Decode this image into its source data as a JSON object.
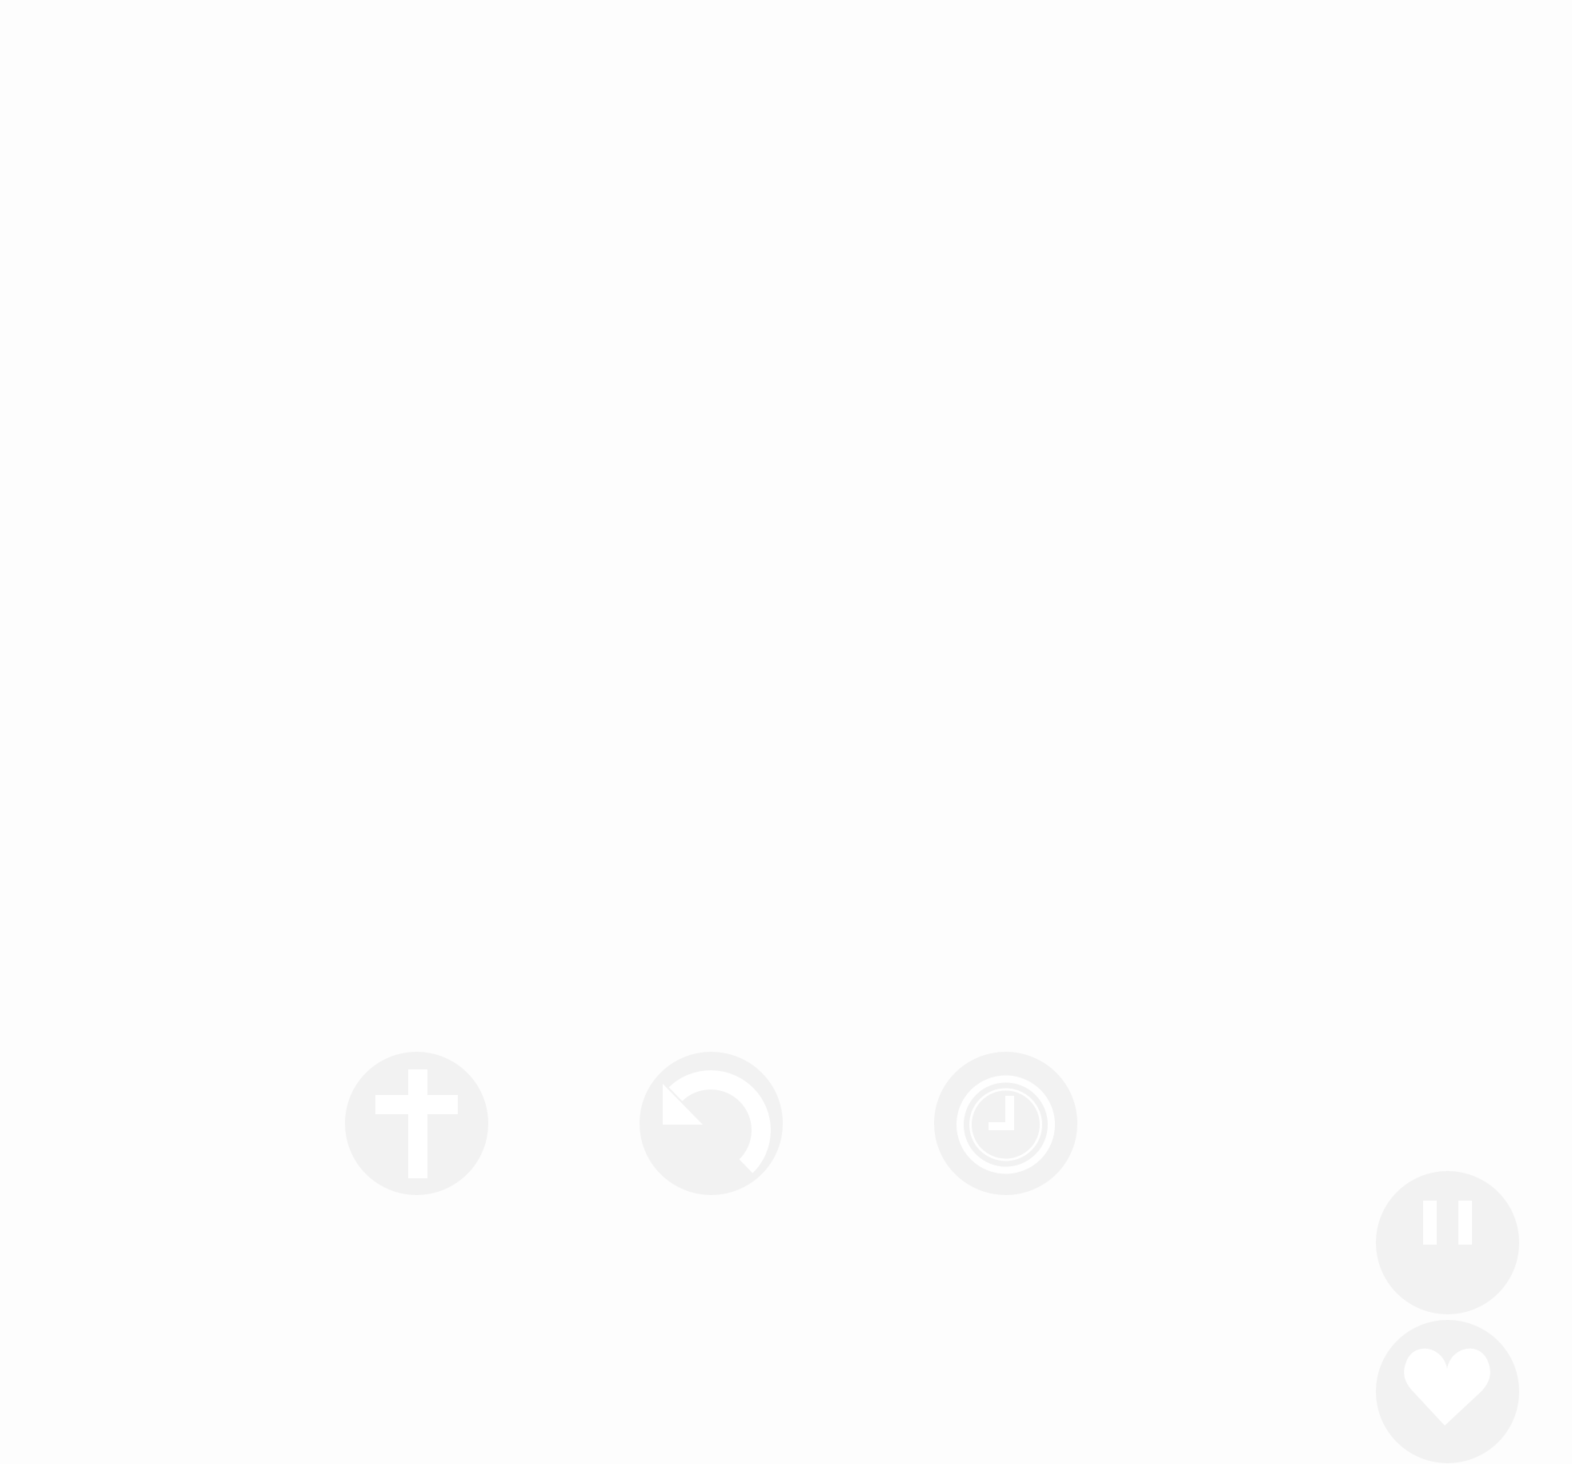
{
  "app": {
    "background_color": "#fdfdfd",
    "button_color": "#f2f2f2",
    "icon_color": "#ffffff"
  },
  "controls": {
    "main_row": [
      {
        "id": "add",
        "icon": "plus-icon",
        "tooltip": ""
      },
      {
        "id": "undo",
        "icon": "undo-icon",
        "tooltip": ""
      },
      {
        "id": "timer",
        "icon": "clock-icon",
        "tooltip": ""
      }
    ],
    "side_stack": [
      {
        "id": "pause",
        "icon": "pause-icon",
        "tooltip": ""
      },
      {
        "id": "like",
        "icon": "heart-icon",
        "tooltip": ""
      }
    ]
  }
}
